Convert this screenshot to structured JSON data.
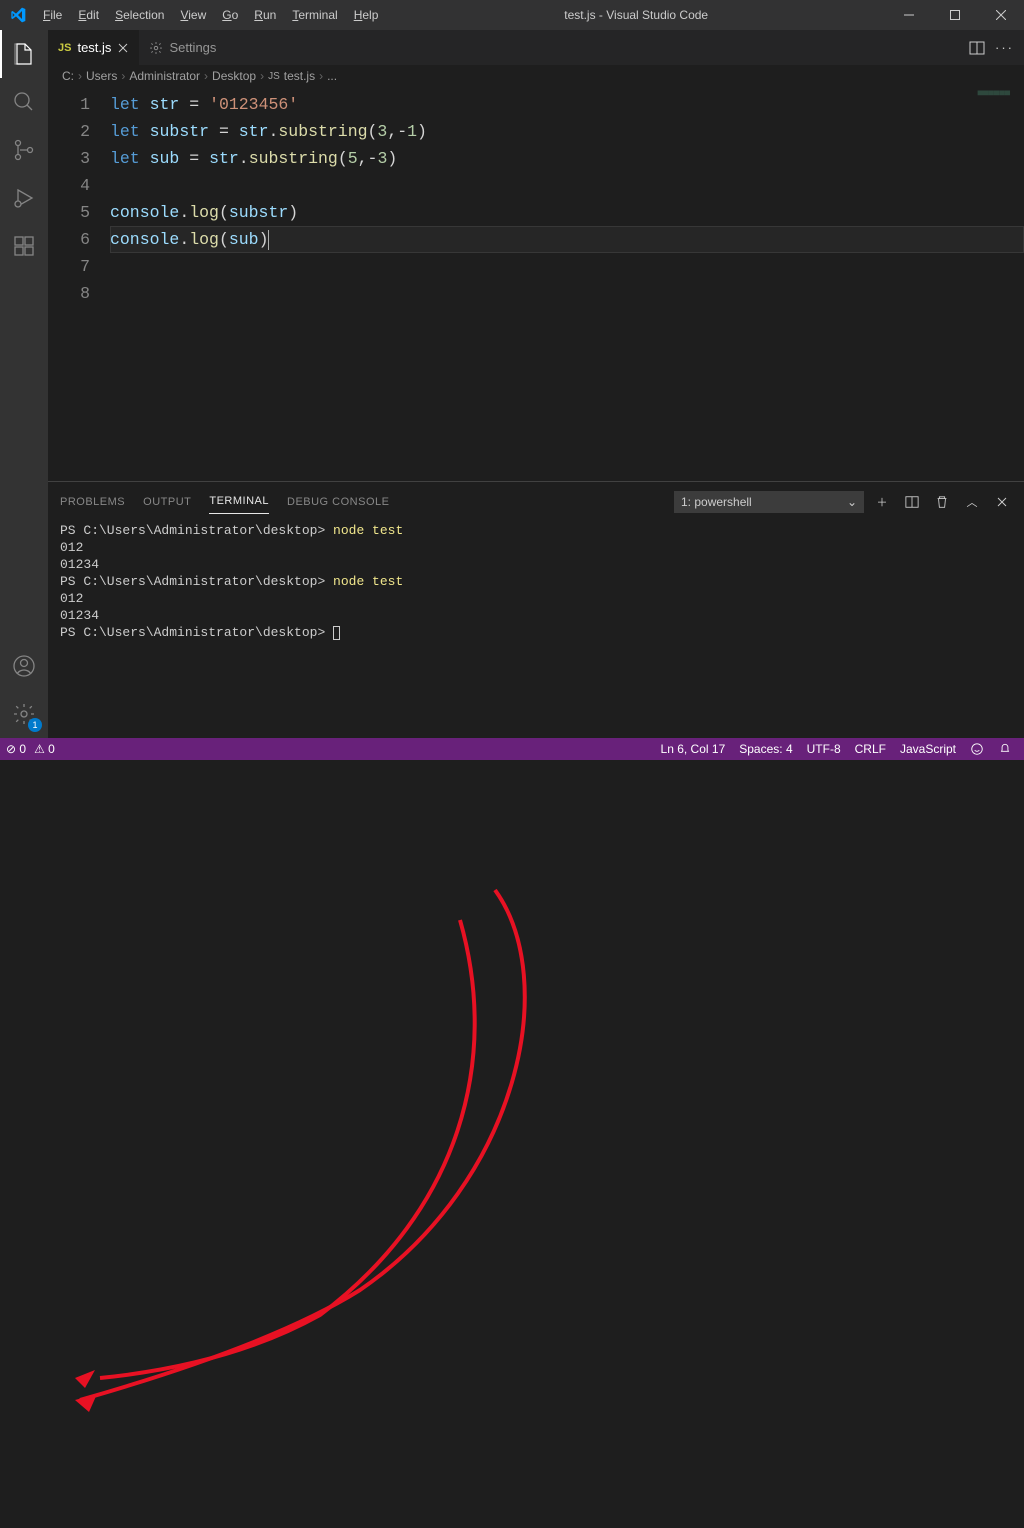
{
  "title": "test.js - Visual Studio Code",
  "menu": [
    "File",
    "Edit",
    "Selection",
    "View",
    "Go",
    "Run",
    "Terminal",
    "Help"
  ],
  "tabs": [
    {
      "label": "test.js",
      "icon": "JS",
      "active": true,
      "dirty": false
    },
    {
      "label": "Settings",
      "icon": "gear",
      "active": false
    }
  ],
  "breadcrumbs": [
    "C:",
    "Users",
    "Administrator",
    "Desktop",
    "test.js",
    "..."
  ],
  "code_lines": [
    [
      [
        "kw",
        "let"
      ],
      [
        "punct",
        " "
      ],
      [
        "var",
        "str"
      ],
      [
        "punct",
        " = "
      ],
      [
        "str",
        "'0123456'"
      ]
    ],
    [
      [
        "kw",
        "let"
      ],
      [
        "punct",
        " "
      ],
      [
        "var",
        "substr"
      ],
      [
        "punct",
        " = "
      ],
      [
        "obj",
        "str"
      ],
      [
        "punct",
        "."
      ],
      [
        "fn",
        "substring"
      ],
      [
        "punct",
        "("
      ],
      [
        "num",
        "3"
      ],
      [
        "punct",
        ",-"
      ],
      [
        "num",
        "1"
      ],
      [
        "punct",
        ")"
      ]
    ],
    [
      [
        "kw",
        "let"
      ],
      [
        "punct",
        " "
      ],
      [
        "var",
        "sub"
      ],
      [
        "punct",
        " = "
      ],
      [
        "obj",
        "str"
      ],
      [
        "punct",
        "."
      ],
      [
        "fn",
        "substring"
      ],
      [
        "punct",
        "("
      ],
      [
        "num",
        "5"
      ],
      [
        "punct",
        ",-"
      ],
      [
        "num",
        "3"
      ],
      [
        "punct",
        ")"
      ]
    ],
    [],
    [
      [
        "obj",
        "console"
      ],
      [
        "punct",
        "."
      ],
      [
        "fn",
        "log"
      ],
      [
        "punct",
        "("
      ],
      [
        "var",
        "substr"
      ],
      [
        "punct",
        ")"
      ]
    ],
    [
      [
        "obj",
        "console"
      ],
      [
        "punct",
        "."
      ],
      [
        "fn",
        "log"
      ],
      [
        "punct",
        "("
      ],
      [
        "var",
        "sub"
      ],
      [
        "punct",
        ")"
      ]
    ],
    [],
    []
  ],
  "current_line": 6,
  "panel": {
    "tabs": [
      "PROBLEMS",
      "OUTPUT",
      "TERMINAL",
      "DEBUG CONSOLE"
    ],
    "active": "TERMINAL",
    "terminal_name": "1: powershell",
    "lines": [
      {
        "prompt": "PS C:\\Users\\Administrator\\desktop> ",
        "cmd": "node test"
      },
      {
        "text": "012"
      },
      {
        "text": "01234"
      },
      {
        "prompt": "PS C:\\Users\\Administrator\\desktop> ",
        "cmd": "node test"
      },
      {
        "text": "012"
      },
      {
        "text": "01234"
      },
      {
        "prompt": "PS C:\\Users\\Administrator\\desktop> ",
        "cursor": true
      }
    ]
  },
  "status": {
    "errors": "0",
    "warnings": "0",
    "ln_col": "Ln 6, Col 17",
    "spaces": "Spaces: 4",
    "encoding": "UTF-8",
    "eol": "CRLF",
    "lang": "JavaScript"
  },
  "gear_badge": "1"
}
